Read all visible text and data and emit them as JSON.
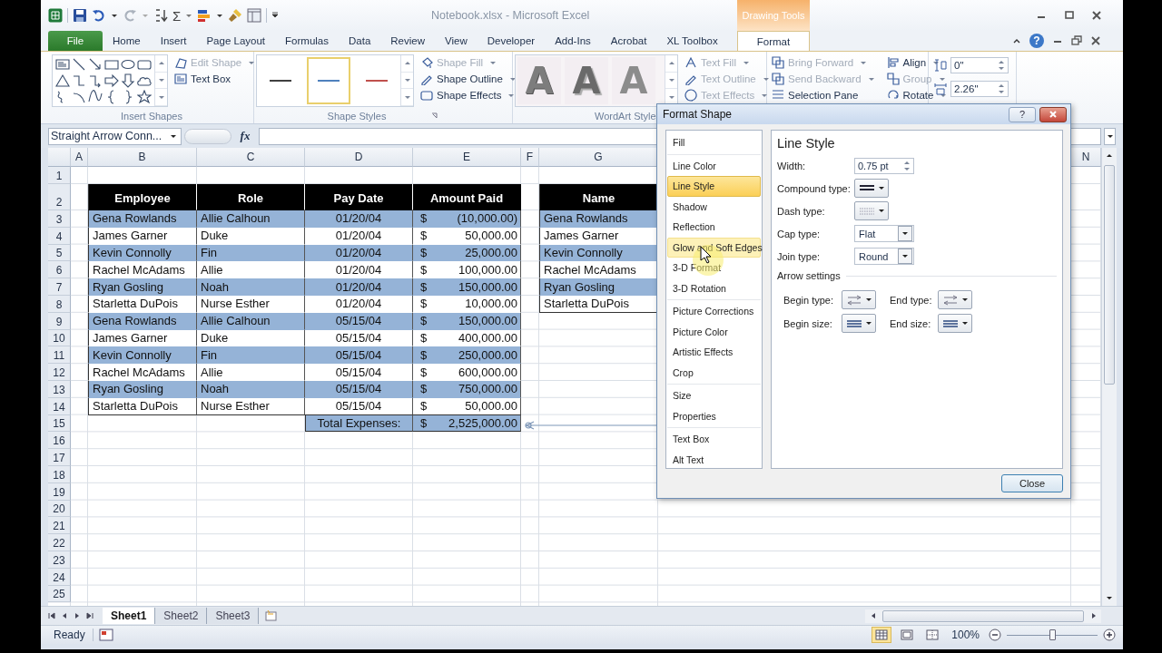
{
  "title_bar": {
    "sum_symbol": "Σ",
    "title": "Notebook.xlsx - Microsoft Excel",
    "context_label": "Drawing Tools",
    "help": "?"
  },
  "ribbon_tabs": [
    {
      "label": "File",
      "kind": "file",
      "selected": false
    },
    {
      "label": "Home",
      "kind": "tab",
      "selected": false
    },
    {
      "label": "Insert",
      "kind": "tab",
      "selected": false
    },
    {
      "label": "Page Layout",
      "kind": "tab",
      "selected": false
    },
    {
      "label": "Formulas",
      "kind": "tab",
      "selected": false
    },
    {
      "label": "Data",
      "kind": "tab",
      "selected": false
    },
    {
      "label": "Review",
      "kind": "tab",
      "selected": false
    },
    {
      "label": "View",
      "kind": "tab",
      "selected": false
    },
    {
      "label": "Developer",
      "kind": "tab",
      "selected": false
    },
    {
      "label": "Add-Ins",
      "kind": "tab",
      "selected": false
    },
    {
      "label": "Acrobat",
      "kind": "tab",
      "selected": false
    },
    {
      "label": "XL Toolbox",
      "kind": "tab",
      "selected": false
    },
    {
      "label": "Format",
      "kind": "contextual",
      "selected": true
    }
  ],
  "ribbon": {
    "insert_shapes": {
      "label": "Insert Shapes",
      "commands": [
        {
          "label": "Edit Shape",
          "disabled": true,
          "menu": true
        },
        {
          "label": "Text Box",
          "disabled": false,
          "menu": false
        }
      ]
    },
    "shape_styles": {
      "label": "Shape Styles",
      "swatches": [
        {
          "color": "#404040",
          "selected": false
        },
        {
          "color": "#4f81bd",
          "selected": true
        },
        {
          "color": "#c0504d",
          "selected": false
        }
      ],
      "commands": [
        {
          "label": "Shape Fill",
          "disabled": true,
          "menu": true
        },
        {
          "label": "Shape Outline",
          "disabled": false,
          "menu": true
        },
        {
          "label": "Shape Effects",
          "disabled": false,
          "menu": true
        }
      ]
    },
    "wordart_styles": {
      "label": "WordArt Style",
      "samples": [
        {
          "text": "A",
          "kind": "outline"
        },
        {
          "text": "A",
          "kind": "bevel"
        },
        {
          "text": "A",
          "kind": "faint"
        }
      ],
      "commands": [
        {
          "label": "Text Fill",
          "disabled": true,
          "menu": true
        },
        {
          "label": "Text Outline",
          "disabled": true,
          "menu": true
        },
        {
          "label": "Text Effects",
          "disabled": true,
          "menu": true
        }
      ]
    },
    "arrange": {
      "commands": [
        {
          "label": "Bring Forward",
          "disabled": true,
          "menu": true
        },
        {
          "label": "Send Backward",
          "disabled": true,
          "menu": true
        },
        {
          "label": "Selection Pane",
          "disabled": false,
          "menu": false
        },
        {
          "label": "Align",
          "disabled": false,
          "menu": true
        },
        {
          "label": "Group",
          "disabled": true,
          "menu": true
        },
        {
          "label": "Rotate",
          "disabled": false,
          "menu": true
        }
      ]
    },
    "size": {
      "height": "0\"",
      "width": "2.26\""
    }
  },
  "formula_bar": {
    "name_box": "Straight Arrow Conn...",
    "function_label": "fx"
  },
  "columns": [
    "A",
    "B",
    "C",
    "D",
    "E",
    "F",
    "G",
    "N"
  ],
  "rows": [
    "1",
    "2",
    "3",
    "4",
    "5",
    "6",
    "7",
    "8",
    "9",
    "10",
    "11",
    "12",
    "13",
    "14",
    "15",
    "16",
    "17",
    "18",
    "19",
    "20",
    "21",
    "22",
    "23",
    "24",
    "25"
  ],
  "employee_table": {
    "headers": [
      "Employee",
      "Role",
      "Pay Date",
      "Amount Paid"
    ],
    "rows": [
      {
        "employee": "Gena Rowlands",
        "role": "Allie Calhoun",
        "pay_date": "01/20/04",
        "currency": "$",
        "amount": "(10,000.00)",
        "shaded": true
      },
      {
        "employee": "James Garner",
        "role": "Duke",
        "pay_date": "01/20/04",
        "currency": "$",
        "amount": "50,000.00",
        "shaded": false
      },
      {
        "employee": "Kevin Connolly",
        "role": "Fin",
        "pay_date": "01/20/04",
        "currency": "$",
        "amount": "25,000.00",
        "shaded": true
      },
      {
        "employee": "Rachel McAdams",
        "role": "Allie",
        "pay_date": "01/20/04",
        "currency": "$",
        "amount": "100,000.00",
        "shaded": false
      },
      {
        "employee": "Ryan Gosling",
        "role": "Noah",
        "pay_date": "01/20/04",
        "currency": "$",
        "amount": "150,000.00",
        "shaded": true
      },
      {
        "employee": "Starletta DuPois",
        "role": "Nurse Esther",
        "pay_date": "01/20/04",
        "currency": "$",
        "amount": "10,000.00",
        "shaded": false
      },
      {
        "employee": "Gena Rowlands",
        "role": "Allie Calhoun",
        "pay_date": "05/15/04",
        "currency": "$",
        "amount": "150,000.00",
        "shaded": true
      },
      {
        "employee": "James Garner",
        "role": "Duke",
        "pay_date": "05/15/04",
        "currency": "$",
        "amount": "400,000.00",
        "shaded": false
      },
      {
        "employee": "Kevin Connolly",
        "role": "Fin",
        "pay_date": "05/15/04",
        "currency": "$",
        "amount": "250,000.00",
        "shaded": true
      },
      {
        "employee": "Rachel McAdams",
        "role": "Allie",
        "pay_date": "05/15/04",
        "currency": "$",
        "amount": "600,000.00",
        "shaded": false
      },
      {
        "employee": "Ryan Gosling",
        "role": "Noah",
        "pay_date": "05/15/04",
        "currency": "$",
        "amount": "750,000.00",
        "shaded": true
      },
      {
        "employee": "Starletta DuPois",
        "role": "Nurse Esther",
        "pay_date": "05/15/04",
        "currency": "$",
        "amount": "50,000.00",
        "shaded": false
      }
    ],
    "total": {
      "label": "Total Expenses:",
      "currency": "$",
      "amount": "2,525,000.00"
    }
  },
  "name_table": {
    "header": "Name",
    "rows": [
      {
        "name": "Gena Rowlands",
        "shaded": true
      },
      {
        "name": "James Garner",
        "shaded": false
      },
      {
        "name": "Kevin Connolly",
        "shaded": true
      },
      {
        "name": "Rachel McAdams",
        "shaded": false
      },
      {
        "name": "Ryan Gosling",
        "shaded": true
      },
      {
        "name": "Starletta DuPois",
        "shaded": false
      }
    ]
  },
  "format_shape_dialog": {
    "title": "Format Shape",
    "help": "?",
    "category_groups": [
      {
        "items": [
          {
            "label": "Fill",
            "selected": false,
            "hovered": false
          }
        ]
      },
      {
        "items": [
          {
            "label": "Line Color",
            "selected": false,
            "hovered": false
          },
          {
            "label": "Line Style",
            "selected": true,
            "hovered": false
          },
          {
            "label": "Shadow",
            "selected": false,
            "hovered": false
          },
          {
            "label": "Reflection",
            "selected": false,
            "hovered": false
          },
          {
            "label": "Glow and Soft Edges",
            "selected": false,
            "hovered": true
          },
          {
            "label": "3-D Format",
            "selected": false,
            "hovered": false
          },
          {
            "label": "3-D Rotation",
            "selected": false,
            "hovered": false
          }
        ]
      },
      {
        "items": [
          {
            "label": "Picture Corrections",
            "selected": false,
            "hovered": false
          },
          {
            "label": "Picture Color",
            "selected": false,
            "hovered": false
          },
          {
            "label": "Artistic Effects",
            "selected": false,
            "hovered": false
          },
          {
            "label": "Crop",
            "selected": false,
            "hovered": false
          }
        ]
      },
      {
        "items": [
          {
            "label": "Size",
            "selected": false,
            "hovered": false
          },
          {
            "label": "Properties",
            "selected": false,
            "hovered": false
          }
        ]
      },
      {
        "items": [
          {
            "label": "Text Box",
            "selected": false,
            "hovered": false
          },
          {
            "label": "Alt Text",
            "selected": false,
            "hovered": false
          }
        ]
      }
    ],
    "pane": {
      "heading": "Line Style",
      "fields": [
        {
          "label": "Width:",
          "kind": "spinner",
          "value": "0.75 pt"
        },
        {
          "label": "Compound type:",
          "kind": "compound"
        },
        {
          "label": "Dash type:",
          "kind": "dash"
        },
        {
          "label": "Cap type:",
          "kind": "select",
          "value": "Flat"
        },
        {
          "label": "Join type:",
          "kind": "select",
          "value": "Round"
        }
      ],
      "arrow_settings": {
        "label": "Arrow settings",
        "fields": [
          {
            "label": "Begin type:",
            "kind": "arrow"
          },
          {
            "label": "End type:",
            "kind": "arrow"
          },
          {
            "label": "Begin size:",
            "kind": "size"
          },
          {
            "label": "End size:",
            "kind": "size"
          }
        ]
      }
    },
    "close_button": "Close"
  },
  "sheet_tabs": [
    {
      "label": "Sheet1",
      "selected": true
    },
    {
      "label": "Sheet2",
      "selected": false
    },
    {
      "label": "Sheet3",
      "selected": false
    }
  ],
  "status_bar": {
    "status": "Ready",
    "views": [
      {
        "kind": "normal",
        "selected": true
      },
      {
        "kind": "layout",
        "selected": false
      },
      {
        "kind": "break",
        "selected": false
      }
    ],
    "zoom": "100%",
    "zoom_slider": {
      "level": 0.5
    }
  }
}
